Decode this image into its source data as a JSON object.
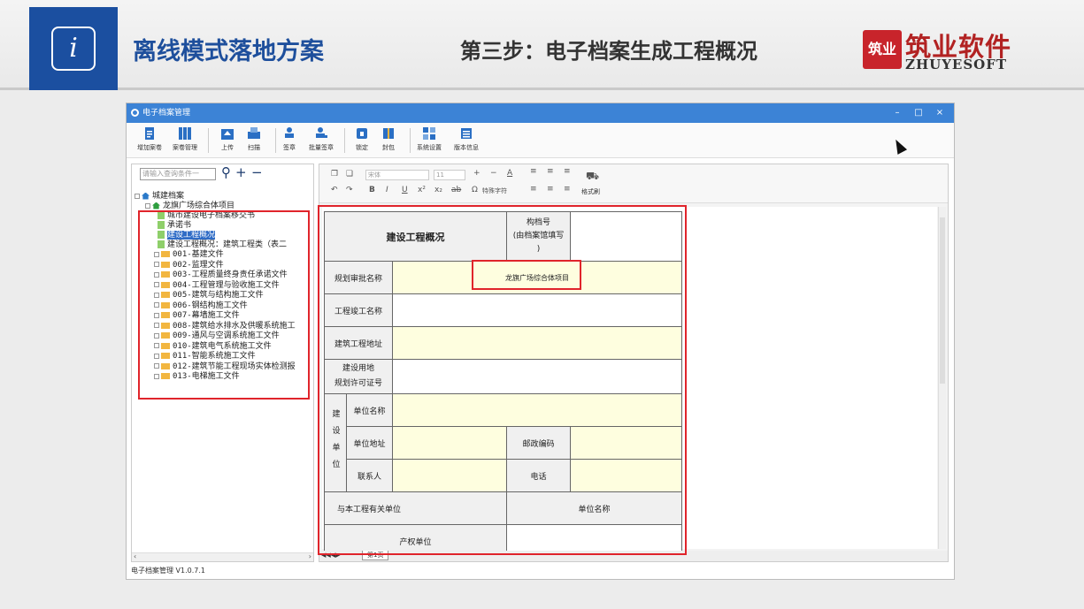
{
  "slide": {
    "title": "离线模式落地方案",
    "step": "第三步：电子档案生成工程概况",
    "logo_cn": "筑业软件",
    "logo_en": "ZHUYESOFT",
    "logo_mark": "筑业",
    "info_icon": "i"
  },
  "window": {
    "title": "电子档案管理",
    "minimize": "–",
    "maximize": "□",
    "close": "×",
    "status": "电子档案管理 V1.0.7.1"
  },
  "toolbar": [
    {
      "label": "增加案卷",
      "icon": "doc-add-icon"
    },
    {
      "label": "案卷管理",
      "icon": "binder-icon"
    },
    {
      "label": "上传",
      "icon": "upload-icon"
    },
    {
      "label": "扫描",
      "icon": "scanner-icon"
    },
    {
      "label": "签章",
      "icon": "stamp-icon"
    },
    {
      "label": "批量签章",
      "icon": "batch-stamp-icon"
    },
    {
      "label": "锁定",
      "icon": "lock-icon"
    },
    {
      "label": "封包",
      "icon": "package-icon"
    },
    {
      "label": "系统设置",
      "icon": "settings-icon"
    },
    {
      "label": "版本信息",
      "icon": "info-list-icon"
    }
  ],
  "search": {
    "placeholder": "请输入查询条件一"
  },
  "tree": {
    "root": "城建档案",
    "project": "龙旗广场综合体项目",
    "docs": [
      "城市建设电子档案移交书",
      "承诺书",
      "建设工程概况",
      "建设工程概况：建筑工程类（表二"
    ],
    "selected_index": 2,
    "folders": [
      "001-基建文件",
      "002-监理文件",
      "003-工程质量终身责任承诺文件",
      "004-工程管理与验收施工文件",
      "005-建筑与结构施工文件",
      "006-钢结构施工文件",
      "007-幕墙施工文件",
      "008-建筑给水排水及供暖系统施工",
      "009-通风与空调系统施工文件",
      "010-建筑电气系统施工文件",
      "011-智能系统施工文件",
      "012-建筑节能工程现场实体检测报",
      "013-电梯施工文件"
    ]
  },
  "format_bar": {
    "font": "宋体",
    "size": "11",
    "special_chars": "特殊字符",
    "format_painter": "格式刷"
  },
  "form": {
    "title": "建设工程概况",
    "archive_no_label": "构档号",
    "archive_no_note": "(由档案馆填写",
    "archive_no_note2": ")",
    "plan_name_label": "规划审批名称",
    "plan_name_value": "龙旗广场综合体项目",
    "completion_name_label": "工程竣工名称",
    "address_label": "建筑工程地址",
    "land_permit_label1": "建设用地",
    "land_permit_label2": "规划许可证号",
    "unit_group_label": "建设单位",
    "unit_name_label": "单位名称",
    "unit_address_label": "单位地址",
    "postcode_label": "邮政编码",
    "contact_label": "联系人",
    "phone_label": "电话",
    "related_units_label": "与本工程有关单位",
    "unit_col_label": "单位名称",
    "property_unit_label": "产权单位"
  },
  "sheet_tab": "第1页"
}
